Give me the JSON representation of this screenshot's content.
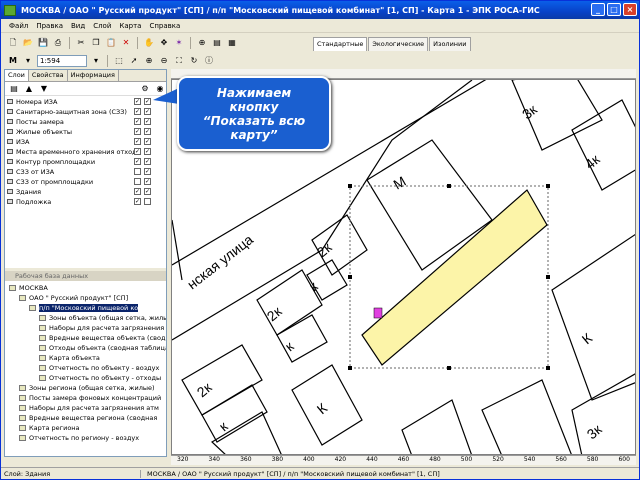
{
  "window": {
    "title": "МОСКВА / ОАО \" Русский продукт\" [СП] / п/п \"Московский пищевой комбинат\" [1, СП]  -  Карта 1  -  ЭПК РОСА-ГИС",
    "minimize": "_",
    "maximize": "□",
    "close": "×"
  },
  "menu": [
    "Файл",
    "Правка",
    "Вид",
    "Слой",
    "Карта",
    "Справка"
  ],
  "toolbar": {
    "scale_value": "1:594",
    "icons": [
      "new-icon",
      "open-icon",
      "save-icon",
      "print-icon",
      "cut-icon",
      "copy-icon",
      "paste-icon",
      "delete-icon",
      "hand-icon",
      "pan-icon",
      "pointer-icon",
      "zoom-in-icon",
      "zoom-out-icon",
      "show-all-map-icon"
    ]
  },
  "map_tabs": [
    "Стандартные",
    "Экологические",
    "Изолинии"
  ],
  "left_panel": {
    "tabs": [
      "Слои",
      "Свойства",
      "Информация"
    ],
    "layers": [
      {
        "name": "Номера ИЗА",
        "c1": "✓",
        "c2": "✓"
      },
      {
        "name": "Санитарно-защитная зона (СЗЗ)",
        "c1": "✓",
        "c2": "✓"
      },
      {
        "name": "Посты замера",
        "c1": "✓",
        "c2": "✓"
      },
      {
        "name": "Жилые объекты",
        "c1": "✓",
        "c2": "✓"
      },
      {
        "name": "ИЗА",
        "c1": "✓",
        "c2": "✓"
      },
      {
        "name": "Места временного хранения отход",
        "c1": "✓",
        "c2": "✓"
      },
      {
        "name": "Контур промплощадки",
        "c1": "✓",
        "c2": "✓"
      },
      {
        "name": "СЗЗ от ИЗА",
        "c1": "",
        "c2": "✓"
      },
      {
        "name": "СЗЗ от промплощадки",
        "c1": "",
        "c2": "✓"
      },
      {
        "name": "Здания",
        "c1": "✓",
        "c2": "✓"
      },
      {
        "name": "Подложка",
        "c1": "✓",
        "c2": ""
      }
    ],
    "db_header": "Рабочая база данных",
    "tree": [
      {
        "label": "МОСКВА",
        "indent": 0
      },
      {
        "label": "ОАО \" Русский продукт\" [СП]",
        "indent": 1
      },
      {
        "label": "п/п \"Московский пищевой ко",
        "indent": 2,
        "selected": true
      },
      {
        "label": "Зоны объекта (общая сетка, жилые)",
        "indent": 3
      },
      {
        "label": "Наборы для расчета загрязнения",
        "indent": 3
      },
      {
        "label": "Вредные вещества объекта (сводная",
        "indent": 3
      },
      {
        "label": "Отходы объекта (сводная таблица)",
        "indent": 3
      },
      {
        "label": "Карта объекта",
        "indent": 3
      },
      {
        "label": "Отчетность по объекту - воздух",
        "indent": 3
      },
      {
        "label": "Отчетность по объекту - отходы",
        "indent": 3
      },
      {
        "label": "Зоны региона (общая сетка, жилые)",
        "indent": 1
      },
      {
        "label": "Посты замера фоновых концентраций",
        "indent": 1
      },
      {
        "label": "Наборы для расчета загрязнения атм",
        "indent": 1
      },
      {
        "label": "Вредные вещества региона (сводная",
        "indent": 1
      },
      {
        "label": "Карта региона",
        "indent": 1
      },
      {
        "label": "Отчетность по региону - воздух",
        "indent": 1
      }
    ]
  },
  "map": {
    "street_label": "нская улица",
    "building_labels": [
      "3к",
      "М",
      "4к",
      "2к",
      "к",
      "2к",
      "к",
      "2к",
      "к",
      "К",
      "3к",
      "К",
      "3К"
    ],
    "ruler_bottom": [
      "320",
      "340",
      "360",
      "380",
      "400",
      "420",
      "440",
      "460",
      "480",
      "500",
      "520",
      "540",
      "560",
      "580",
      "600"
    ],
    "highlight_color": "#fcf4a8"
  },
  "callout": {
    "text": "Нажимаем\nкнопку\n“Показать всю\nкарту”"
  },
  "statusbar": {
    "layer": "Слой: Здания",
    "path": "МОСКВА / ОАО \" Русский продукт\" [СП] / п/п \"Московский пищевой комбинат\" [1, СП]"
  }
}
